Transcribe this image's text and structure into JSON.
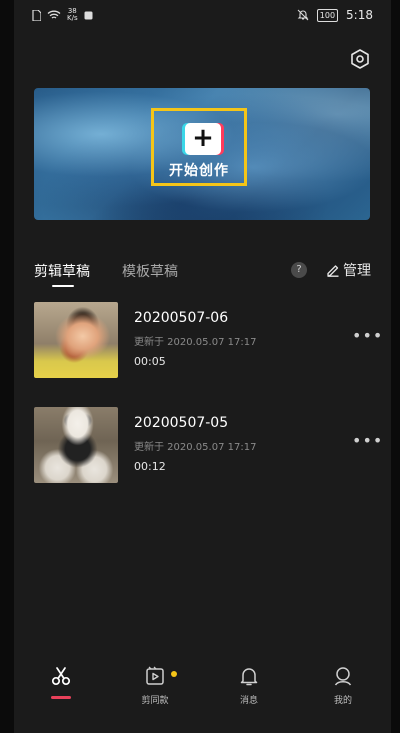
{
  "status_bar": {
    "net_speed_value": "38",
    "net_speed_unit": "K/s",
    "battery": "100",
    "time": "5:18"
  },
  "banner": {
    "create_label": "开始创作",
    "create_symbol": "+"
  },
  "tabs": {
    "active": "剪辑草稿",
    "inactive": "模板草稿",
    "help_symbol": "?",
    "manage_label": "管理"
  },
  "drafts": [
    {
      "name": "20200507-06",
      "updated": "更新于 2020.05.07 17:17",
      "duration": "00:05"
    },
    {
      "name": "20200507-05",
      "updated": "更新于 2020.05.07 17:17",
      "duration": "00:12"
    }
  ],
  "more_symbol": "•••",
  "bottom_nav": {
    "items": [
      {
        "label": "",
        "icon": "scissors-icon"
      },
      {
        "label": "剪同款",
        "icon": "template-icon"
      },
      {
        "label": "消息",
        "icon": "bell-icon"
      },
      {
        "label": "我的",
        "icon": "profile-icon"
      }
    ]
  },
  "colors": {
    "accent": "#f5c518",
    "active_indicator": "#e8415a",
    "background": "#1b1b1b"
  }
}
